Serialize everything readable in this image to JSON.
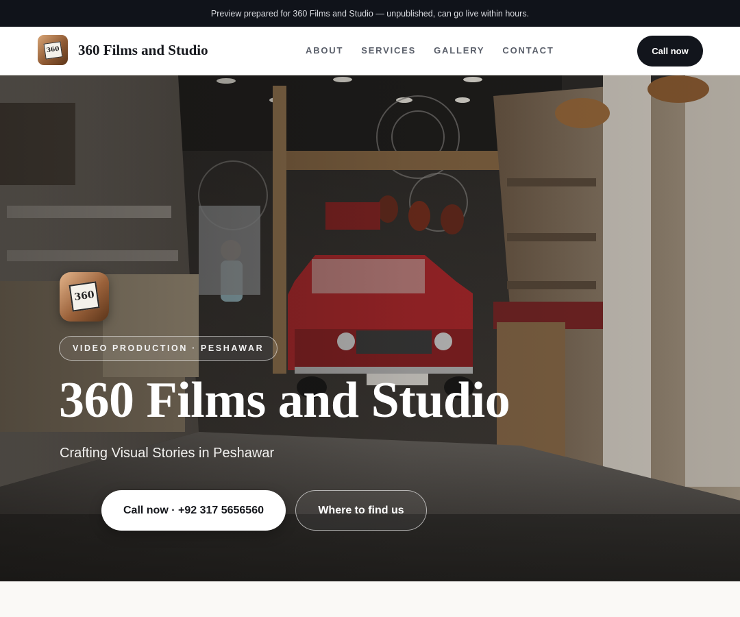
{
  "announcement": "Preview prepared for 360 Films and Studio — unpublished, can go live within hours.",
  "brand": {
    "name": "360 Films and Studio",
    "logo_text": "360"
  },
  "nav": {
    "links": [
      "ABOUT",
      "SERVICES",
      "GALLERY",
      "CONTACT"
    ],
    "cta": "Call now"
  },
  "hero": {
    "eyebrow": "VIDEO PRODUCTION · PESHAWAR",
    "title": "360 Films and Studio",
    "subtitle": "Crafting Visual Stories in Peshawar",
    "primary_cta": "Call now · +92 317 5656560",
    "secondary_cta": "Where to find us",
    "background_image": "shop-interior-red-car-photo"
  },
  "colors": {
    "dark": "#12151c",
    "topbar": "#10131a",
    "accent_red": "#c2282b",
    "page_bg": "#faf9f6"
  }
}
